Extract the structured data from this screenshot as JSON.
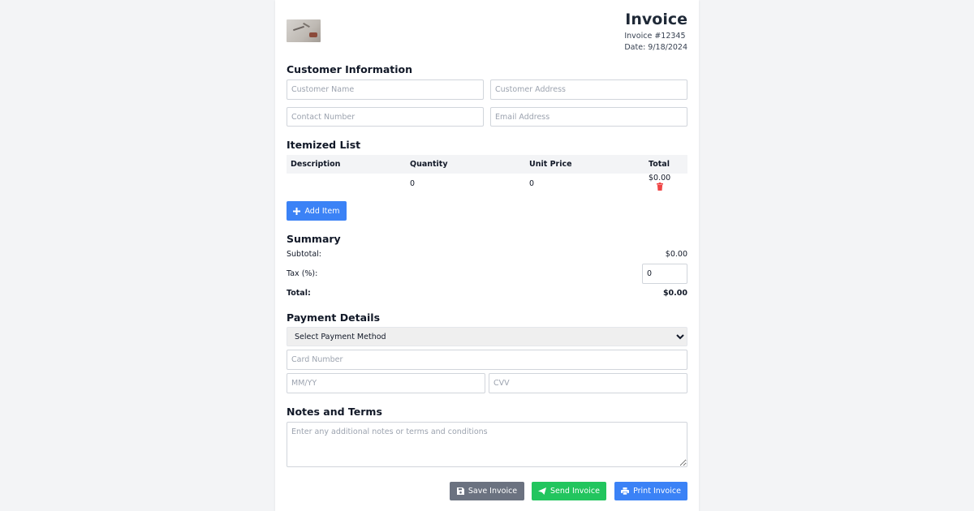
{
  "invoice": {
    "title": "Invoice",
    "number": "Invoice #12345",
    "date": "Date: 9/18/2024"
  },
  "customer": {
    "heading": "Customer Information",
    "name_placeholder": "Customer Name",
    "address_placeholder": "Customer Address",
    "contact_placeholder": "Contact Number",
    "email_placeholder": "Email Address"
  },
  "items": {
    "heading": "Itemized List",
    "columns": [
      "Description",
      "Quantity",
      "Unit Price",
      "Total"
    ],
    "rows": [
      {
        "description": "",
        "quantity": "0",
        "unit_price": "0",
        "total": "$0.00"
      }
    ],
    "add_label": "Add Item"
  },
  "summary": {
    "heading": "Summary",
    "subtotal_label": "Subtotal:",
    "subtotal_value": "$0.00",
    "tax_label": "Tax (%):",
    "tax_value": "0",
    "total_label": "Total:",
    "total_value": "$0.00"
  },
  "payment": {
    "heading": "Payment Details",
    "method_selected": "Select Payment Method",
    "card_placeholder": "Card Number",
    "expiry_placeholder": "MM/YY",
    "cvv_placeholder": "CVV"
  },
  "notes": {
    "heading": "Notes and Terms",
    "placeholder": "Enter any additional notes or terms and conditions"
  },
  "actions": {
    "save_label": "Save Invoice",
    "send_label": "Send Invoice",
    "print_label": "Print Invoice"
  },
  "colors": {
    "primary": "#3b82f6",
    "secondary": "#6b7280",
    "success": "#22c55e",
    "danger": "#ef4444"
  },
  "icons": [
    "logo-image",
    "plus-icon",
    "trash-icon",
    "save-icon",
    "send-icon",
    "print-icon"
  ]
}
